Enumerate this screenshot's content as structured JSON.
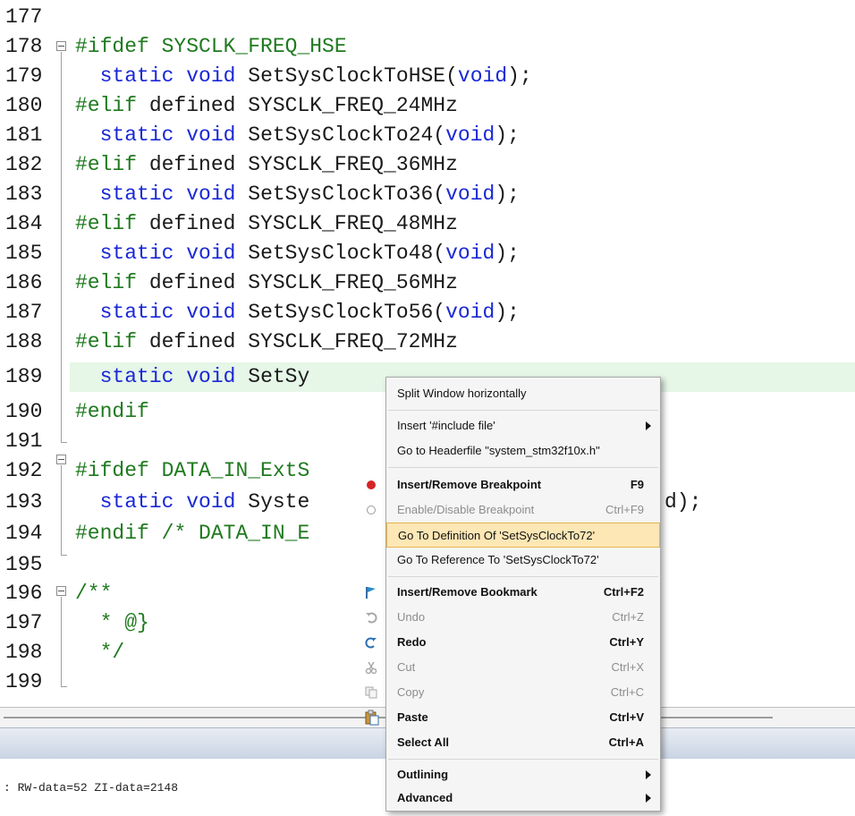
{
  "editor": {
    "lines": [
      {
        "num": "177",
        "code": ""
      },
      {
        "num": "178",
        "code": "#ifdef SYSCLK_FREQ_HSE"
      },
      {
        "num": "179",
        "code": "  static void SetSysClockToHSE(void);"
      },
      {
        "num": "180",
        "code": "#elif defined SYSCLK_FREQ_24MHz"
      },
      {
        "num": "181",
        "code": "  static void SetSysClockTo24(void);"
      },
      {
        "num": "182",
        "code": "#elif defined SYSCLK_FREQ_36MHz"
      },
      {
        "num": "183",
        "code": "  static void SetSysClockTo36(void);"
      },
      {
        "num": "184",
        "code": "#elif defined SYSCLK_FREQ_48MHz"
      },
      {
        "num": "185",
        "code": "  static void SetSysClockTo48(void);"
      },
      {
        "num": "186",
        "code": "#elif defined SYSCLK_FREQ_56MHz"
      },
      {
        "num": "187",
        "code": "  static void SetSysClockTo56(void);"
      },
      {
        "num": "188",
        "code": "#elif defined SYSCLK_FREQ_72MHz"
      },
      {
        "num": "189",
        "code": "  static void SetSy"
      },
      {
        "num": "190",
        "code": "#endif"
      },
      {
        "num": "191",
        "code": ""
      },
      {
        "num": "192",
        "code": "#ifdef DATA_IN_ExtS"
      },
      {
        "num": "193",
        "code": "  static void Syste"
      },
      {
        "num": "194",
        "code": "#endif /* DATA_IN_E"
      },
      {
        "num": "195",
        "code": ""
      },
      {
        "num": "196",
        "code": "/**"
      },
      {
        "num": "197",
        "code": "  * @}"
      },
      {
        "num": "198",
        "code": "  */"
      },
      {
        "num": "199",
        "code": ""
      }
    ],
    "line193_tail": "d);"
  },
  "output": {
    "text": ": RW-data=52 ZI-data=2148"
  },
  "context_menu": {
    "items": [
      {
        "label": "Split Window horizontally",
        "shortcut": ""
      },
      {
        "label": "Insert '#include file'",
        "shortcut": ""
      },
      {
        "label": "Go to Headerfile \"system_stm32f10x.h\"",
        "shortcut": ""
      },
      {
        "label": "Insert/Remove Breakpoint",
        "shortcut": "F9"
      },
      {
        "label": "Enable/Disable Breakpoint",
        "shortcut": "Ctrl+F9"
      },
      {
        "label": "Go To Definition Of 'SetSysClockTo72'",
        "shortcut": ""
      },
      {
        "label": "Go To Reference To 'SetSysClockTo72'",
        "shortcut": ""
      },
      {
        "label": "Insert/Remove Bookmark",
        "shortcut": "Ctrl+F2"
      },
      {
        "label": "Undo",
        "shortcut": "Ctrl+Z"
      },
      {
        "label": "Redo",
        "shortcut": "Ctrl+Y"
      },
      {
        "label": "Cut",
        "shortcut": "Ctrl+X"
      },
      {
        "label": "Copy",
        "shortcut": "Ctrl+C"
      },
      {
        "label": "Paste",
        "shortcut": "Ctrl+V"
      },
      {
        "label": "Select All",
        "shortcut": "Ctrl+A"
      },
      {
        "label": "Outlining",
        "shortcut": ""
      },
      {
        "label": "Advanced",
        "shortcut": ""
      }
    ]
  },
  "colors": {
    "keyword": "#1a28d6",
    "preprocessor": "#1f7a1f",
    "current_line": "#e6f6e7",
    "menu_highlight": "#fde7b5"
  }
}
